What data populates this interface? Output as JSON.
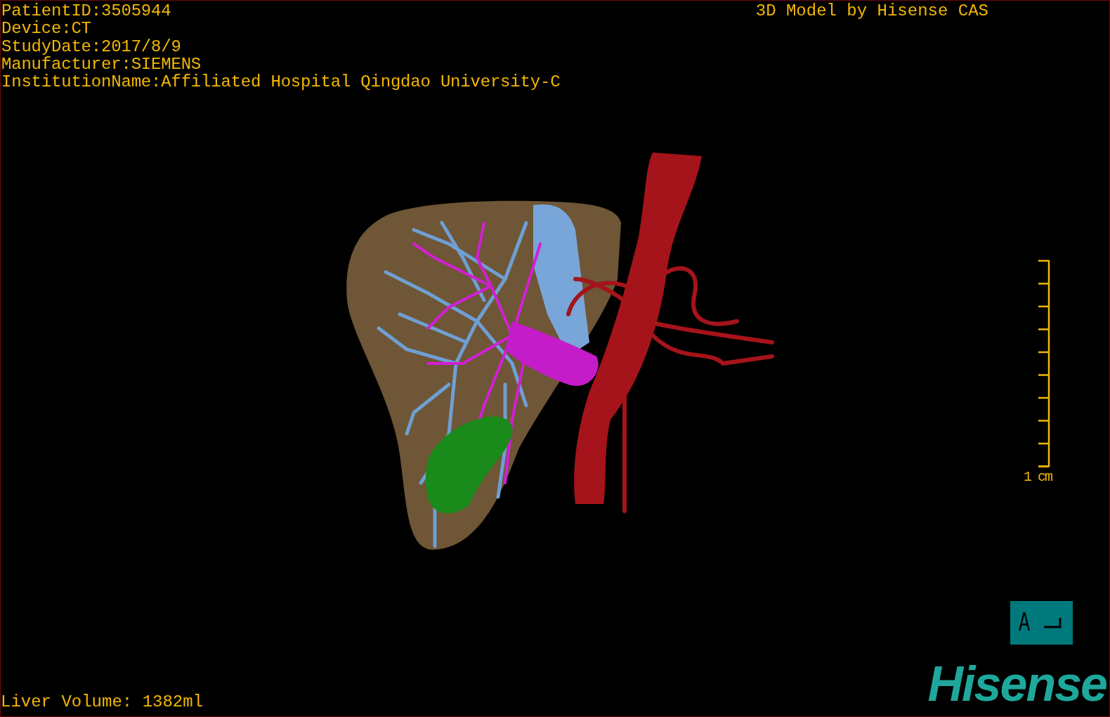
{
  "info_lines": [
    "PatientID:3505944",
    "Device:CT",
    "StudyDate:2017/8/9",
    "Manufacturer:SIEMENS",
    "InstitutionName:Affiliated Hospital Qingdao University-C"
  ],
  "title": "3D Model by Hisense CAS",
  "scale_bar": {
    "label": "1 cm"
  },
  "orientation_marker": {
    "label": "A"
  },
  "liver_volume": "Liver Volume: 1382ml",
  "logo": "Hisense"
}
